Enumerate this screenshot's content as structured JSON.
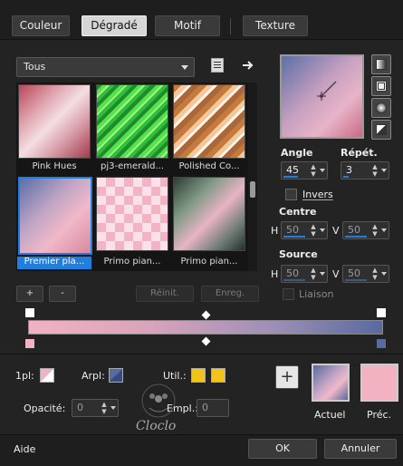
{
  "tabs": [
    {
      "label": "Couleur"
    },
    {
      "label": "Dégradé"
    },
    {
      "label": "Motif"
    },
    {
      "label": "Texture"
    }
  ],
  "library": {
    "dropdown_value": "Tous",
    "items": [
      {
        "label": "Pink Hues"
      },
      {
        "label": "pj3-emerald..."
      },
      {
        "label": "Polished Co..."
      },
      {
        "label": "Premier pla..."
      },
      {
        "label": "Primo pian..."
      },
      {
        "label": "Primo pian..."
      }
    ],
    "buttons": {
      "add": "+",
      "remove": "-",
      "reset": "Réinit.",
      "save": "Enreg."
    }
  },
  "settings": {
    "angle_label": "Angle",
    "angle_value": "45",
    "repeat_label": "Répét.",
    "repeat_value": "3",
    "invert_label": "Invers",
    "center_label": "Centre",
    "center_h_label": "H",
    "center_h": "50",
    "center_v_label": "V",
    "center_v": "50",
    "source_label": "Source",
    "source_h_label": "H",
    "source_h": "50",
    "source_v_label": "V",
    "source_v": "50",
    "link_label": "Liaison"
  },
  "editor": {
    "first_label": "1pl:",
    "back_label": "Arpl:",
    "user_label": "Util.:",
    "opacity_label": "Opacité:",
    "opacity_value": "0",
    "location_label": "Empl.:",
    "location_value": "0",
    "current_label": "Actuel",
    "previous_label": "Préc.",
    "add_symbol": "+"
  },
  "watermark": "Cloclo",
  "footer": {
    "help": "Aide",
    "ok": "OK",
    "cancel": "Annuler"
  },
  "colors": {
    "accent": "#1e7fe0",
    "pink": "#f3b2c2",
    "blue": "#586a9e",
    "user_yellow": "#f2c419"
  }
}
